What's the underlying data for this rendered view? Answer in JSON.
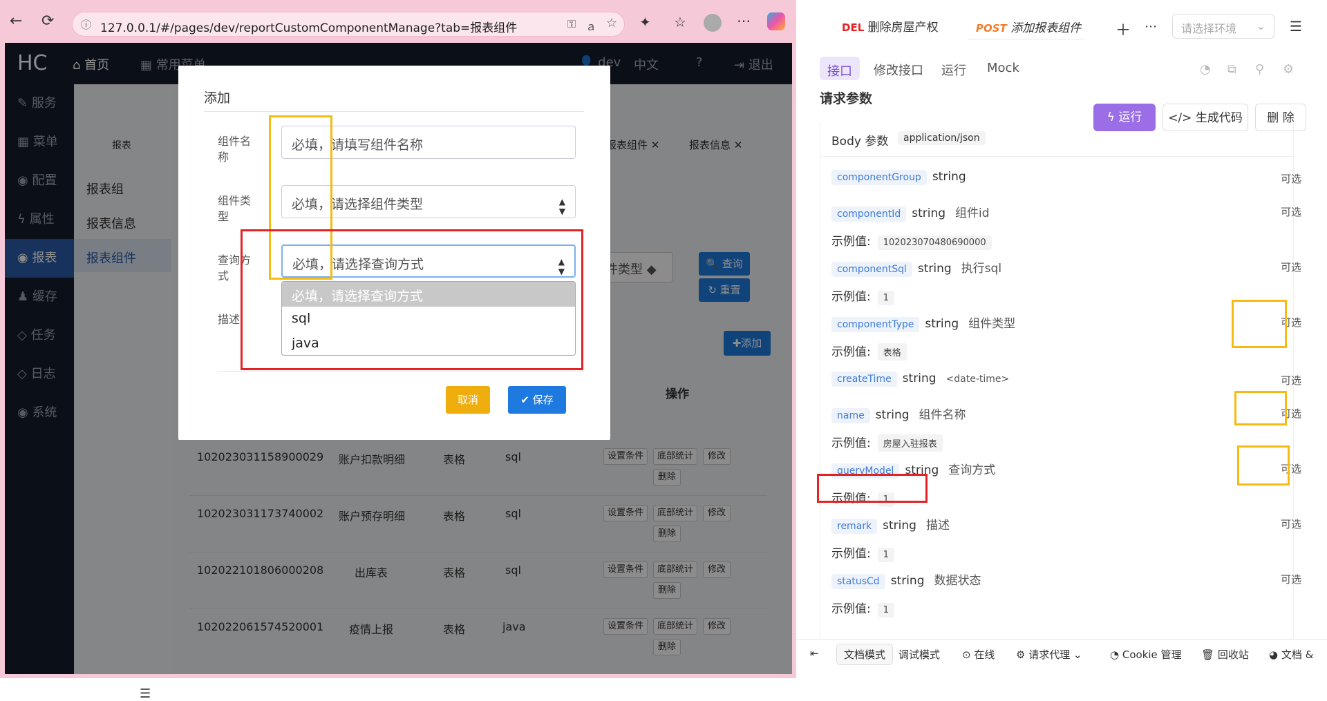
{
  "browser": {
    "url": "127.0.0.1/#/pages/dev/reportCustomComponentManage?tab=报表组件"
  },
  "app": {
    "logo": "HC",
    "nav": {
      "home": "首页",
      "common_menu": "常用菜单",
      "user": "dev",
      "lang": "中文",
      "logout": "退出"
    },
    "sidebar": [
      {
        "label": "服务"
      },
      {
        "label": "菜单"
      },
      {
        "label": "配置"
      },
      {
        "label": "属性"
      },
      {
        "label": "报表"
      },
      {
        "label": "缓存"
      },
      {
        "label": "任务"
      },
      {
        "label": "日志"
      },
      {
        "label": "系统"
      }
    ],
    "subside_header": "报表",
    "subside": [
      {
        "label": "报表组"
      },
      {
        "label": "报表信息"
      },
      {
        "label": "报表组件"
      }
    ],
    "tabs": [
      {
        "label": "报表组件"
      },
      {
        "label": "报表信息"
      }
    ],
    "filter_partial": "件类型",
    "query_btn": "查询",
    "reset_btn": "重置",
    "add_btn": "添加",
    "ops_header": "操作",
    "rows": [
      {
        "id": "102023031158900029",
        "name": "账户扣款明细",
        "type": "表格",
        "mode": "sql"
      },
      {
        "id": "102023031173740002",
        "name": "账户预存明细",
        "type": "表格",
        "mode": "sql"
      },
      {
        "id": "102022101806000208",
        "name": "出库表",
        "type": "表格",
        "mode": "sql"
      },
      {
        "id": "102022061574520001",
        "name": "疫情上报",
        "type": "表格",
        "mode": "java"
      }
    ],
    "row_actions": {
      "cond": "设置条件",
      "stat": "底部统计",
      "edit": "修改",
      "del": "删除"
    }
  },
  "modal": {
    "title": "添加",
    "fields": [
      {
        "label": "组件名称",
        "placeholder": "必填，请填写组件名称"
      },
      {
        "label": "组件类型",
        "value": "必填，请选择组件类型"
      },
      {
        "label": "查询方式",
        "value": "必填，请选择查询方式"
      },
      {
        "label": "描述"
      }
    ],
    "dropdown": [
      "必填，请选择查询方式",
      "sql",
      "java"
    ],
    "cancel": "取消",
    "save": "保存"
  },
  "right": {
    "tabs": [
      {
        "method": "DEL",
        "label": "删除房屋产权"
      },
      {
        "method": "POST",
        "label": "添加报表组件"
      }
    ],
    "env_placeholder": "请选择环境",
    "subtabs": [
      "接口",
      "修改接口",
      "运行",
      "Mock"
    ],
    "section_title": "请求参数",
    "run_btn": "运行",
    "gen_btn": "生成代码",
    "del_btn": "删 除",
    "body_label": "Body 参数",
    "content_type": "application/json",
    "example_label": "示例值:",
    "optional": "可选",
    "params": [
      {
        "name": "componentGroup",
        "type": "string",
        "desc": "",
        "example": ""
      },
      {
        "name": "componentId",
        "type": "string",
        "desc": "组件id",
        "example": "102023070480690000"
      },
      {
        "name": "componentSql",
        "type": "string",
        "desc": "执行sql",
        "example": "1"
      },
      {
        "name": "componentType",
        "type": "string",
        "desc": "组件类型",
        "example": "表格"
      },
      {
        "name": "createTime",
        "type": "string",
        "desc": "<date-time>",
        "example": ""
      },
      {
        "name": "name",
        "type": "string",
        "desc": "组件名称",
        "example": "房屋入驻报表"
      },
      {
        "name": "queryModel",
        "type": "string",
        "desc": "查询方式",
        "example": "1"
      },
      {
        "name": "remark",
        "type": "string",
        "desc": "描述",
        "example": "1"
      },
      {
        "name": "statusCd",
        "type": "string",
        "desc": "数据状态",
        "example": "1"
      }
    ],
    "bottom": [
      "文档模式",
      "调试模式",
      "在线",
      "请求代理",
      "Cookie 管理",
      "回收站",
      "文档 &"
    ]
  },
  "colors": {
    "red_box": "#e32323",
    "yellow_box": "#f6bb12",
    "primary": "#1f7ae0",
    "accent_purple": "#9b6ee8",
    "warning": "#f0ad0e"
  }
}
